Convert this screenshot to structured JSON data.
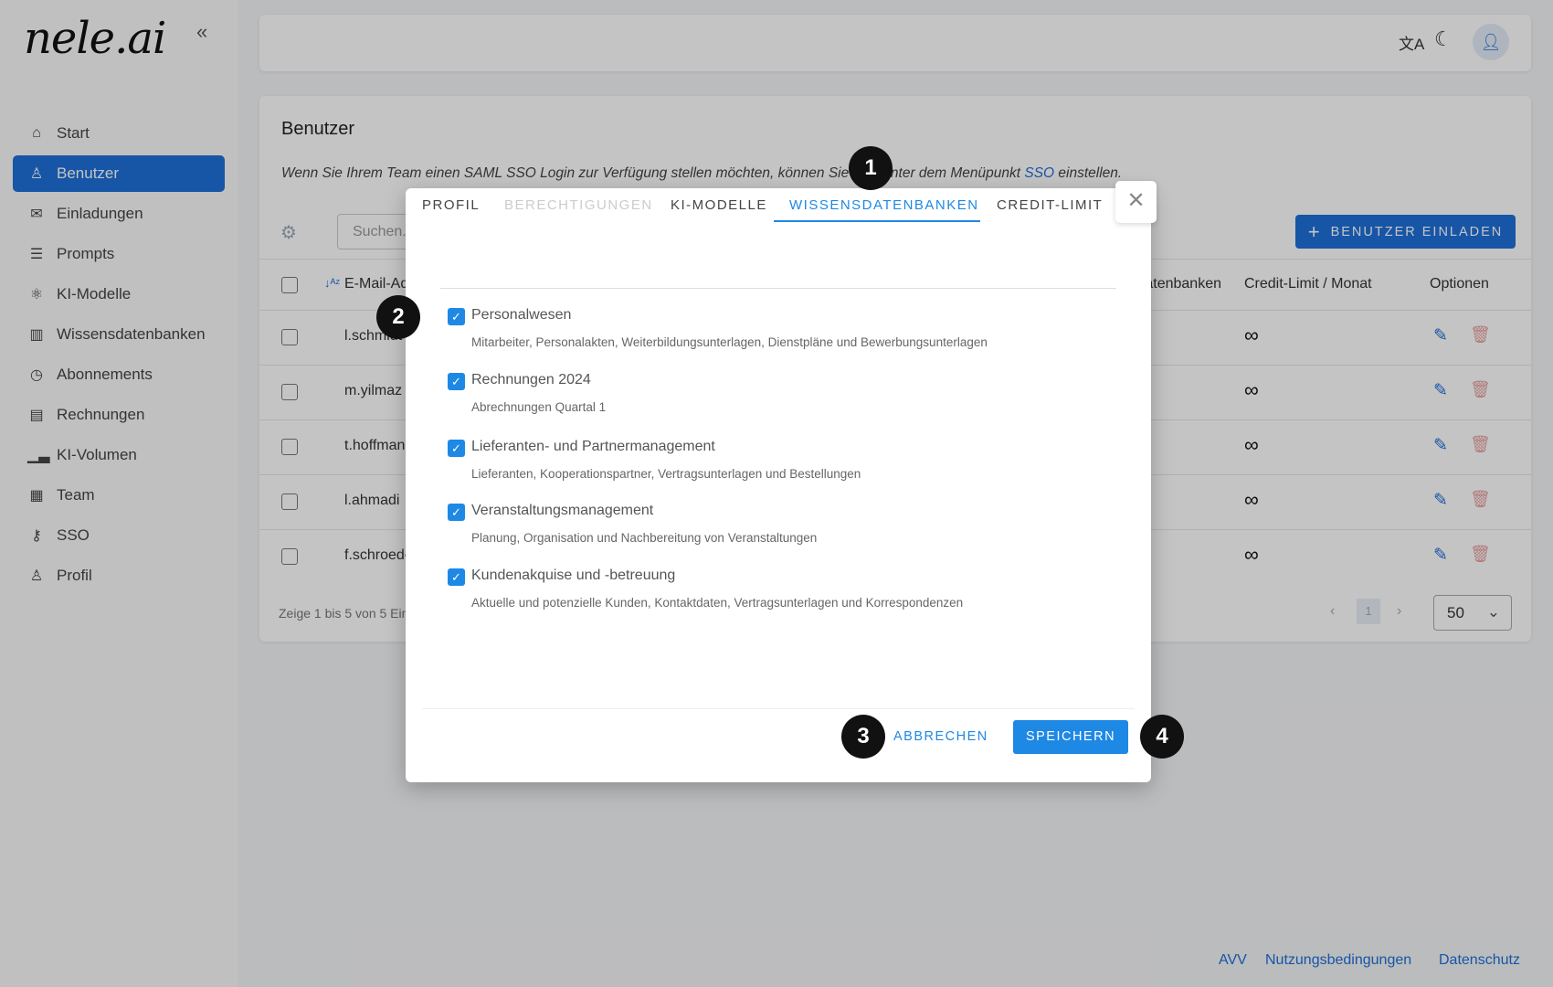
{
  "brand": {
    "logo": "nele.ai",
    "collapse_icon": "double-chevron-left-icon"
  },
  "sidebar": {
    "items": [
      {
        "label": "Start",
        "icon": "home-icon"
      },
      {
        "label": "Benutzer",
        "icon": "user-icon",
        "active": true
      },
      {
        "label": "Einladungen",
        "icon": "mailbox-icon"
      },
      {
        "label": "Prompts",
        "icon": "prompt-icon"
      },
      {
        "label": "KI-Modelle",
        "icon": "atom-icon"
      },
      {
        "label": "Wissensdatenbanken",
        "icon": "library-icon"
      },
      {
        "label": "Abonnements",
        "icon": "clock-icon"
      },
      {
        "label": "Rechnungen",
        "icon": "clipboard-icon"
      },
      {
        "label": "KI-Volumen",
        "icon": "chart-icon"
      },
      {
        "label": "Team",
        "icon": "building-icon"
      },
      {
        "label": "SSO",
        "icon": "key-icon"
      },
      {
        "label": "Profil",
        "icon": "user-icon"
      }
    ]
  },
  "topbar": {
    "icons": [
      "translate-icon",
      "moon-icon",
      "avatar-icon"
    ]
  },
  "main": {
    "title": "Benutzer",
    "info_pre": "Wenn Sie Ihrem Team einen SAML SSO Login zur Verfügung stellen möchten, können Sie dies unter dem Menüpunkt ",
    "info_link": "SSO",
    "info_post": " einstellen.",
    "search_placeholder": "Suchen...",
    "invite_button": "BENUTZER EINLADEN",
    "columns": {
      "email": "E-Mail-Adresse",
      "kb": "Wissensdatenbanken",
      "credit": "Credit-Limit / Monat",
      "options": "Optionen"
    },
    "rows": [
      {
        "email": "l.schmidt",
        "credit": "∞"
      },
      {
        "email": "m.yilmaz",
        "credit": "∞"
      },
      {
        "email": "t.hoffmann",
        "credit": "∞"
      },
      {
        "email": "l.ahmadi",
        "credit": "∞"
      },
      {
        "email": "f.schroeder",
        "credit": "∞"
      }
    ],
    "footer_text": "Zeige 1 bis 5 von 5 Einträgen",
    "page": "1",
    "page_size": "50"
  },
  "modal": {
    "tabs": [
      {
        "label": "PROFIL"
      },
      {
        "label": "BERECHTIGUNGEN",
        "disabled": true
      },
      {
        "label": "KI-MODELLE"
      },
      {
        "label": "WISSENSDATENBANKEN",
        "active": true
      },
      {
        "label": "CREDIT-LIMIT"
      }
    ],
    "items": [
      {
        "title": "Personalwesen",
        "desc": "Mitarbeiter, Personalakten, Weiterbildungsunterlagen, Dienstpläne und Bewerbungsunterlagen",
        "checked": true
      },
      {
        "title": "Rechnungen 2024",
        "desc": "Abrechnungen Quartal 1",
        "checked": true
      },
      {
        "title": "Lieferanten- und Partnermanagement",
        "desc": "Lieferanten, Kooperationspartner, Vertragsunterlagen und Bestellungen",
        "checked": true
      },
      {
        "title": "Veranstaltungsmanagement",
        "desc": "Planung, Organisation und Nachbereitung von Veranstaltungen",
        "checked": true
      },
      {
        "title": "Kundenakquise und -betreuung",
        "desc": "Aktuelle und potenzielle Kunden, Kontaktdaten, Vertragsunterlagen und Korrespondenzen",
        "checked": true
      }
    ],
    "cancel": "ABBRECHEN",
    "save": "SPEICHERN"
  },
  "annotations": [
    "1",
    "2",
    "3",
    "4"
  ],
  "footer": {
    "links": [
      "AVV",
      "Nutzungsbedingungen",
      "Datenschutz"
    ]
  },
  "colors": {
    "accent": "#1e6fd9",
    "checkbox": "#1e88e5",
    "badge": "#111111"
  }
}
